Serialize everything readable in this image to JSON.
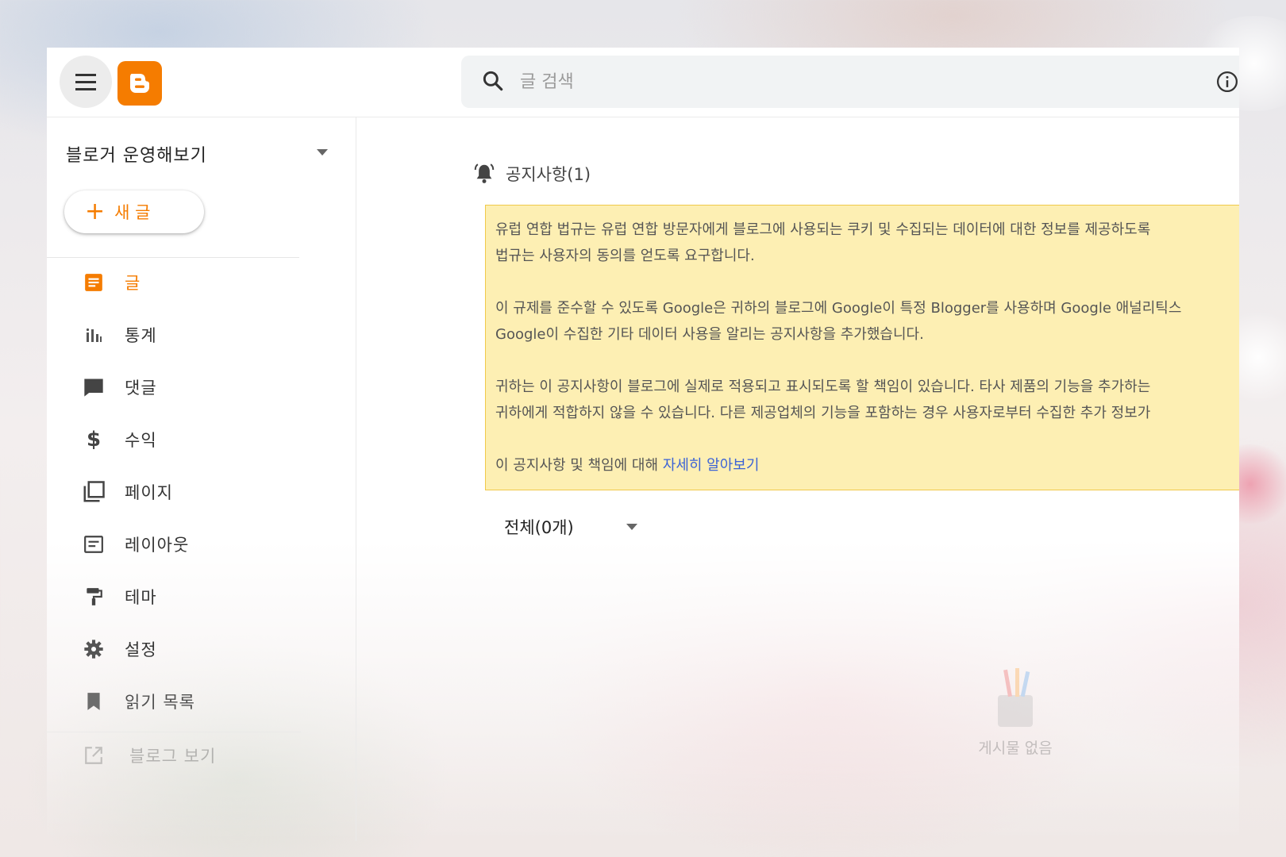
{
  "header": {
    "search_placeholder": "글 검색"
  },
  "sidebar": {
    "blog_name": "블로거 운영해보기",
    "new_post_label": "새 글",
    "items": [
      {
        "label": "글",
        "icon": "posts-icon",
        "active": true
      },
      {
        "label": "통계",
        "icon": "stats-icon",
        "active": false
      },
      {
        "label": "댓글",
        "icon": "comment-icon",
        "active": false
      },
      {
        "label": "수익",
        "icon": "dollar-icon",
        "active": false
      },
      {
        "label": "페이지",
        "icon": "pages-icon",
        "active": false
      },
      {
        "label": "레이아웃",
        "icon": "layout-icon",
        "active": false
      },
      {
        "label": "테마",
        "icon": "paint-roller-icon",
        "active": false
      },
      {
        "label": "설정",
        "icon": "gear-icon",
        "active": false
      },
      {
        "label": "읽기 목록",
        "icon": "bookmark-icon",
        "active": false
      },
      {
        "label": "블로그 보기",
        "icon": "open-external-icon",
        "active": false
      }
    ]
  },
  "main": {
    "notice_title": "공지사항(1)",
    "notice": {
      "line1": "유럽 연합 법규는 유럽 연합 방문자에게 블로그에 사용되는 쿠키 및 수집되는 데이터에 대한 정보를 제공하도록",
      "line2": "법규는 사용자의 동의를 얻도록 요구합니다.",
      "line3": "이 규제를 준수할 수 있도록 Google은 귀하의 블로그에 Google이 특정 Blogger를 사용하며 Google 애널리틱스",
      "line4": "Google이 수집한 기타 데이터 사용을 알리는 공지사항을 추가했습니다.",
      "line5": "귀하는 이 공지사항이 블로그에 실제로 적용되고 표시되도록 할 책임이 있습니다. 타사 제품의 기능을 추가하는",
      "line6": "귀하에게 적합하지 않을 수 있습니다. 다른 제공업체의 기능을 포함하는 경우 사용자로부터 수집한 추가 정보가",
      "line7_prefix": "이 공지사항 및 책임에 대해 ",
      "learn_more": "자세히 알아보기"
    },
    "filter_label": "전체(0개)",
    "empty_text": "게시물 없음"
  },
  "colors": {
    "accent": "#f57c00",
    "notice_bg": "#fdefb3",
    "notice_border": "#f0c94a",
    "link": "#3b62d6"
  }
}
